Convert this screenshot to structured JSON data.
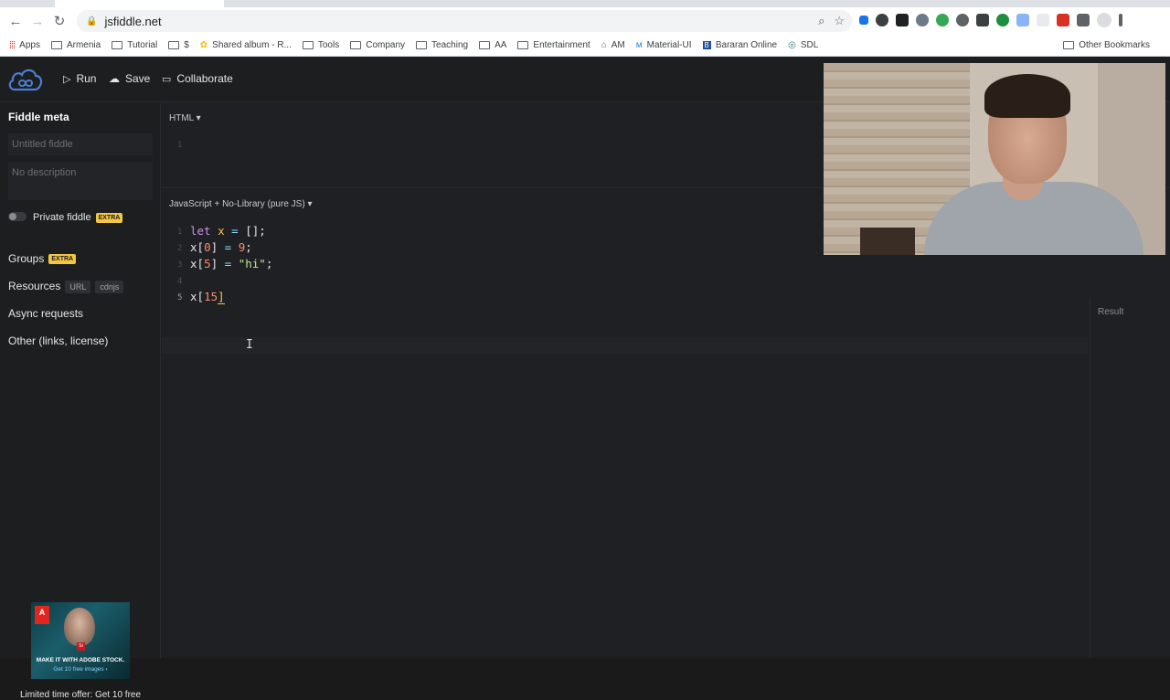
{
  "browser": {
    "url": "jsfiddle.net",
    "bookmarks": [
      "Apps",
      "Armenia",
      "Tutorial",
      "$",
      "Shared album - R...",
      "Tools",
      "Company",
      "Teaching",
      "AA",
      "Entertainment",
      "AM",
      "Material-UI",
      "Bararan Online",
      "SDL"
    ],
    "other_bookmarks": "Other Bookmarks"
  },
  "toolbar": {
    "run_label": "Run",
    "save_label": "Save",
    "collaborate_label": "Collaborate"
  },
  "sidebar": {
    "title": "Fiddle meta",
    "title_placeholder": "Untitled fiddle",
    "description_placeholder": "No description",
    "private_label": "Private fiddle",
    "extra_badge": "EXTRA",
    "groups_label": "Groups",
    "resources_label": "Resources",
    "resources_tags": [
      "URL",
      "cdnjs"
    ],
    "async_label": "Async requests",
    "other_label": "Other (links, license)"
  },
  "ad": {
    "brand": "Adobe",
    "headline": "MAKE IT WITH ADOBE STOCK.",
    "sub": "Get 10 free images ›",
    "offer": "Limited time offer: Get 10 free"
  },
  "editors": {
    "html_label": "HTML ▾",
    "html_line": "1",
    "js_label": "JavaScript + No-Library (pure JS) ▾",
    "line_numbers": [
      "1",
      "2",
      "3",
      "4",
      "5"
    ],
    "result_label": "Result"
  },
  "code": {
    "line1": {
      "kw": "let",
      "var": "x",
      "op": "=",
      "rest": "[];"
    },
    "line2": {
      "a": "x[",
      "num": "0",
      "b": "]",
      "op": "=",
      "num2": "9",
      "end": ";"
    },
    "line3": {
      "a": "x[",
      "num": "5",
      "b": "]",
      "op": "=",
      "str": "\"hi\"",
      "end": ";"
    },
    "line5": {
      "a": "x[",
      "num": "15",
      "b": "]"
    }
  },
  "colors": {
    "accent_yellow": "#f2c744",
    "keyword": "#c792ea",
    "number": "#f78c6c",
    "string": "#c3e88d",
    "background": "#1d1e20"
  }
}
